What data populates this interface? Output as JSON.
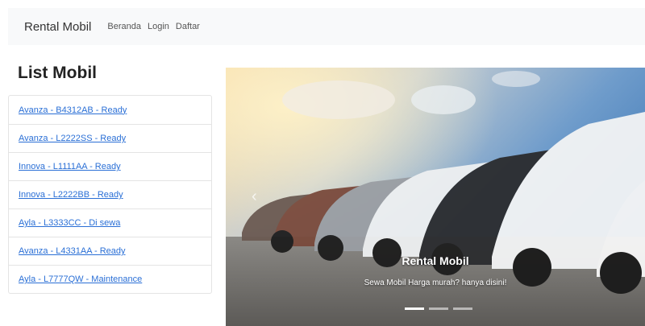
{
  "navbar": {
    "brand": "Rental Mobil",
    "links": [
      "Beranda",
      "Login",
      "Daftar"
    ]
  },
  "sidebar": {
    "title": "List Mobil",
    "items": [
      "Avanza - B4312AB - Ready",
      "Avanza - L2222SS - Ready",
      "Innova - L1111AA - Ready",
      "Innova - L2222BB - Ready",
      "Ayla - L3333CC - Di sewa",
      "Avanza - L4331AA - Ready",
      "Ayla - L7777QW - Maintenance"
    ]
  },
  "carousel": {
    "caption_title": "Rental Mobil",
    "caption_text": "Sewa Mobil Harga murah? hanya disini!",
    "prev_icon": "chevron-left-icon",
    "active_slide": 1,
    "slide_count": 3
  },
  "colors": {
    "navbar_bg": "#f8f9fa",
    "link": "#2a6fd6",
    "border": "#e4e4e4"
  }
}
